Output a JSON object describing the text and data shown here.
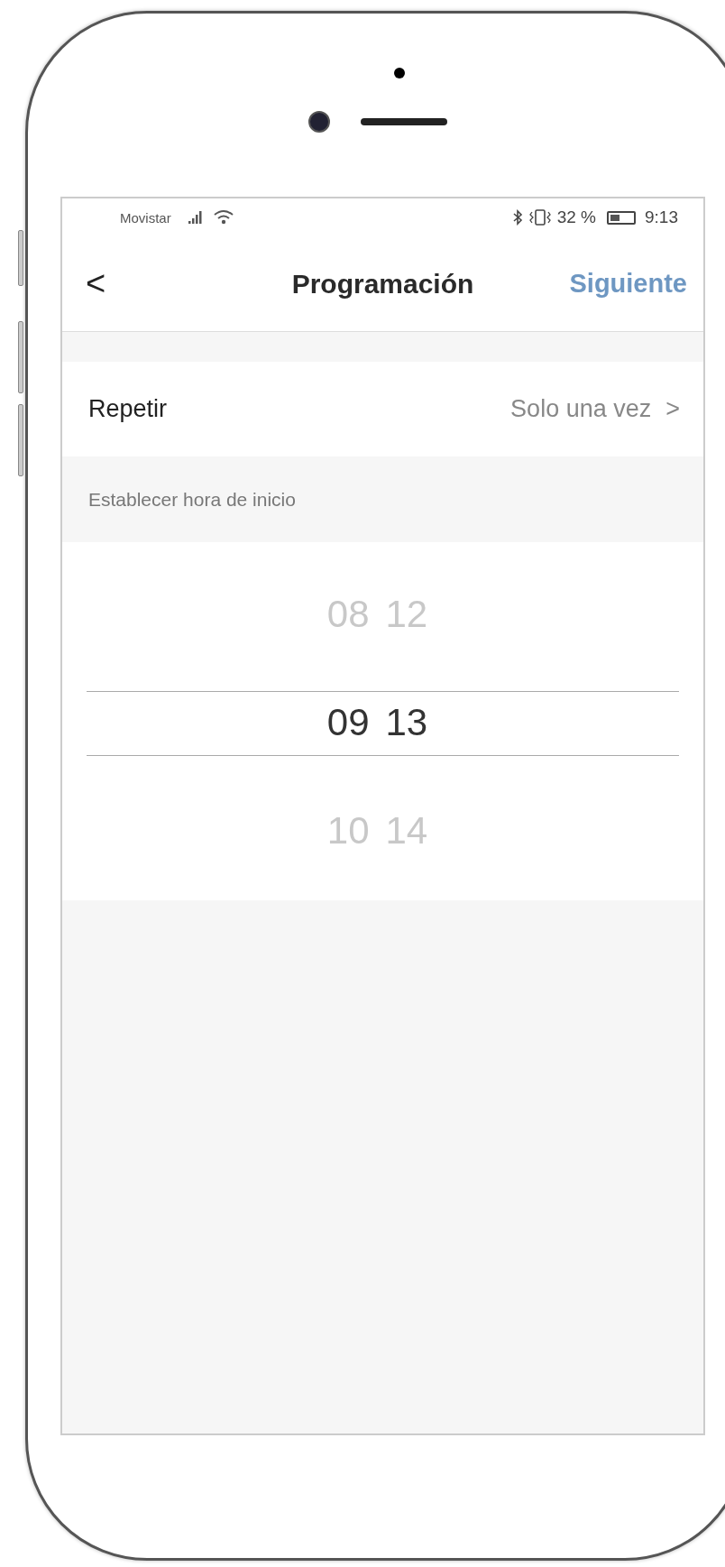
{
  "status_bar": {
    "carrier": "Movistar",
    "battery_percent": "32 %",
    "time": "9:13"
  },
  "header": {
    "back": "<",
    "title": "Programación",
    "action": "Siguiente"
  },
  "repeat_row": {
    "label": "Repetir",
    "value": "Solo una vez",
    "chevron": ">"
  },
  "section_label": "Establecer hora de inicio",
  "time_picker": {
    "hours": [
      {
        "value": "08",
        "selected": false
      },
      {
        "value": "09",
        "selected": true
      },
      {
        "value": "10",
        "selected": false
      }
    ],
    "minutes": [
      {
        "value": "12",
        "selected": false
      },
      {
        "value": "13",
        "selected": true
      },
      {
        "value": "14",
        "selected": false
      }
    ]
  }
}
